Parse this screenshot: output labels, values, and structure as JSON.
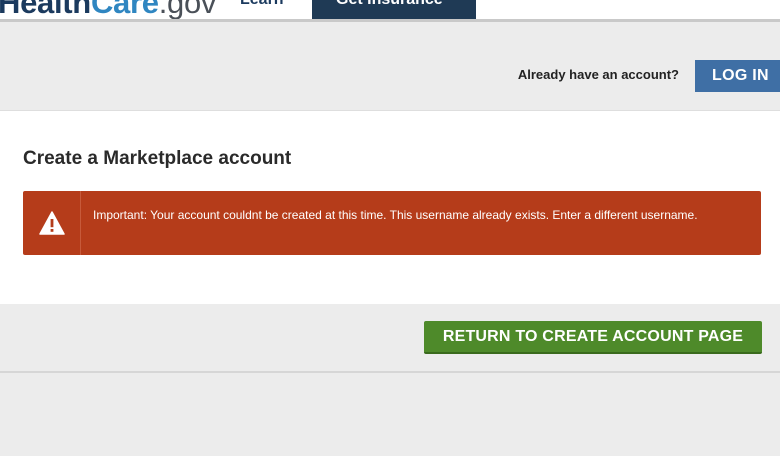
{
  "header": {
    "logo": {
      "part_health": "Health",
      "part_care": "Care",
      "part_gov": ".gov"
    },
    "nav": {
      "learn_label": "Learn",
      "get_insurance_label": "Get Insurance"
    }
  },
  "account_strip": {
    "already_text": "Already have an account?",
    "login_label": "LOG IN"
  },
  "main": {
    "title": "Create a Marketplace account",
    "alert": {
      "icon": "warning-icon",
      "message": "Important: Your account couldnt be created at this time. This username already exists. Enter a different username."
    }
  },
  "actions": {
    "return_label": "RETURN TO CREATE ACCOUNT PAGE"
  },
  "colors": {
    "alert_background": "#b53c1a",
    "login_button": "#3f6fa5",
    "return_button": "#4e8a2a",
    "nav_active": "#1f3a55"
  }
}
